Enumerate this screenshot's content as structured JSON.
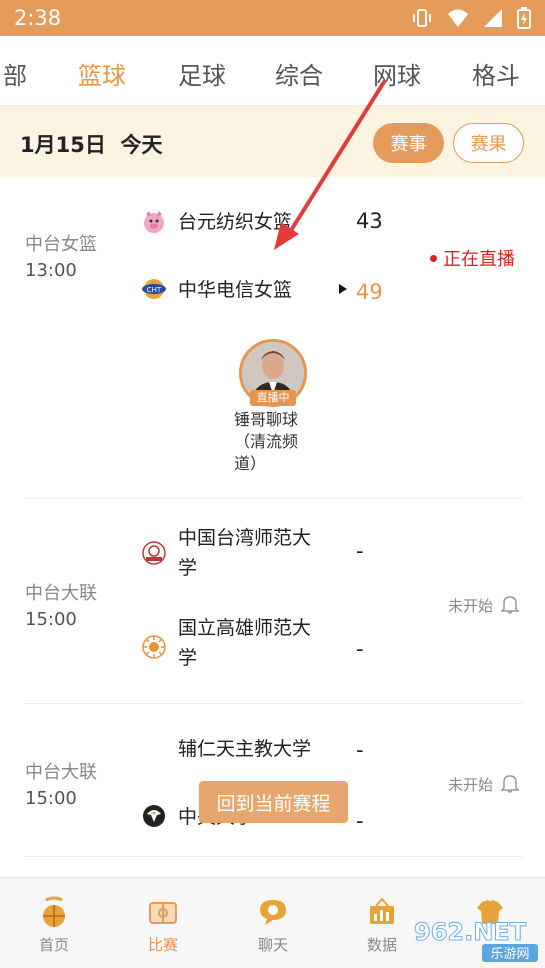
{
  "status_bar": {
    "time": "2:38"
  },
  "tabs": [
    {
      "label": "全部",
      "shown": "部"
    },
    {
      "label": "篮球"
    },
    {
      "label": "足球"
    },
    {
      "label": "综合"
    },
    {
      "label": "网球"
    },
    {
      "label": "格斗"
    }
  ],
  "date_bar": {
    "date": "1月15日  今天",
    "filter_events": "赛事",
    "filter_results": "赛果"
  },
  "matches": [
    {
      "league": "中台女篮",
      "time": "13:00",
      "home": {
        "name": "台元纺织女篮",
        "score": "43"
      },
      "away": {
        "name": "中华电信女篮",
        "score": "49"
      },
      "status": "正在直播",
      "anchor": {
        "badge": "直播中",
        "name": "锤哥聊球（清流频道）"
      }
    },
    {
      "league": "中台大联",
      "time": "15:00",
      "home": {
        "name": "中国台湾师范大学",
        "score": "-"
      },
      "away": {
        "name": "国立高雄师范大学",
        "score": "-"
      },
      "status": "未开始"
    },
    {
      "league": "中台大联",
      "time": "15:00",
      "home": {
        "name": "辅仁天主教大学",
        "score": "-"
      },
      "away": {
        "name": "中央大学",
        "score": "-"
      },
      "status": "未开始"
    }
  ],
  "floating_button": "回到当前赛程",
  "bottom_nav": [
    {
      "label": "首页"
    },
    {
      "label": "比赛"
    },
    {
      "label": "聊天"
    },
    {
      "label": "数据"
    },
    {
      "label": ""
    }
  ],
  "watermark": {
    "brand": "962.NET",
    "site": "乐游网"
  },
  "colors": {
    "accent": "#e59b5a",
    "live_red": "#e02020",
    "date_bar_bg": "#fdf3e1"
  }
}
